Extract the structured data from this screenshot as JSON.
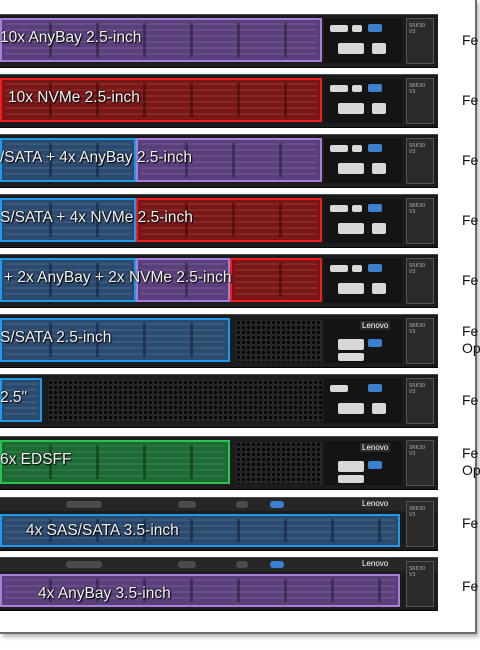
{
  "configs": [
    {
      "label": "10x AnyBay 2.5-inch",
      "caption": [
        "Fe"
      ]
    },
    {
      "label": "10x NVMe 2.5-inch",
      "caption": [
        "Fe"
      ]
    },
    {
      "label": "/SATA + 4x AnyBay 2.5-inch",
      "caption": [
        "Fe"
      ]
    },
    {
      "label": "S/SATA + 4x NVMe 2.5-inch",
      "caption": [
        "Fe"
      ]
    },
    {
      "label": "+ 2x AnyBay + 2x NVMe 2.5-inch",
      "caption": [
        "Fe"
      ]
    },
    {
      "label": "S/SATA 2.5-inch",
      "caption": [
        "Fe",
        "Op"
      ]
    },
    {
      "label": "2.5\"",
      "caption": [
        "Fe"
      ]
    },
    {
      "label": "6x EDSFF",
      "caption": [
        "Fe",
        "Op"
      ]
    },
    {
      "label": "4x SAS/SATA 3.5-inch",
      "caption": [
        "Fe"
      ]
    },
    {
      "label": "4x AnyBay 3.5-inch",
      "caption": [
        "Fe"
      ]
    }
  ],
  "branding": {
    "logo": "Lenovo",
    "pull_tab": "SR630 V3"
  },
  "colors": {
    "anybay": "#a77fd6",
    "nvme": "#f01d1d",
    "sas_sata": "#1e9ae8",
    "edsff": "#2bc251"
  }
}
